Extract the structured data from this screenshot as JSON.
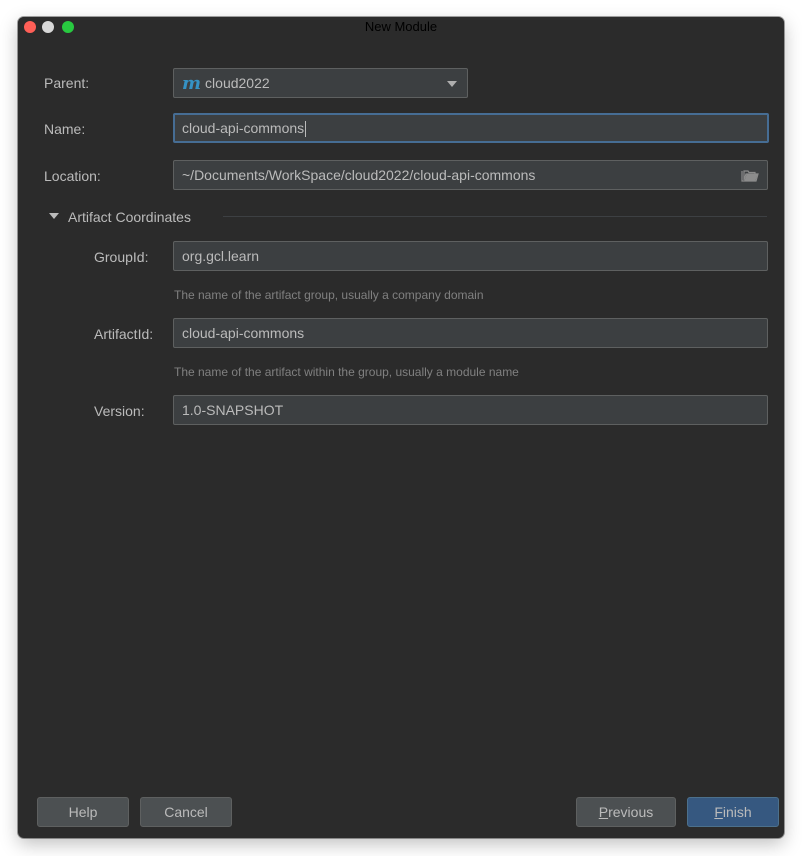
{
  "window": {
    "title": "New Module"
  },
  "form": {
    "parent_label": "Parent:",
    "parent_value": "cloud2022",
    "name_label": "Name:",
    "name_value": "cloud-api-commons",
    "location_label": "Location:",
    "location_value": "~/Documents/WorkSpace/cloud2022/cloud-api-commons"
  },
  "artifact": {
    "section_title": "Artifact Coordinates",
    "group_label": "GroupId:",
    "group_value": "org.gcl.learn",
    "group_hint": "The name of the artifact group, usually a company domain",
    "artifact_label": "ArtifactId:",
    "artifact_value": "cloud-api-commons",
    "artifact_hint": "The name of the artifact within the group, usually a module name",
    "version_label": "Version:",
    "version_value": "1.0-SNAPSHOT"
  },
  "buttons": {
    "help": "Help",
    "cancel": "Cancel",
    "previous_mnemonic": "P",
    "previous_rest": "revious",
    "finish_mnemonic": "F",
    "finish_rest": "inish"
  },
  "icons": {
    "maven": "maven-m-icon",
    "folder": "folder-icon",
    "dropdown": "chevron-down-icon",
    "section_toggle": "triangle-down-icon"
  },
  "colors": {
    "background": "#2b2b2b",
    "field_bg": "#3c3f41",
    "focus_border": "#466d94",
    "primary_button": "#365880",
    "maven_icon": "#3592c4",
    "close": "#ff5f57",
    "minimize": "#d8d8d8",
    "maximize": "#28c940"
  }
}
